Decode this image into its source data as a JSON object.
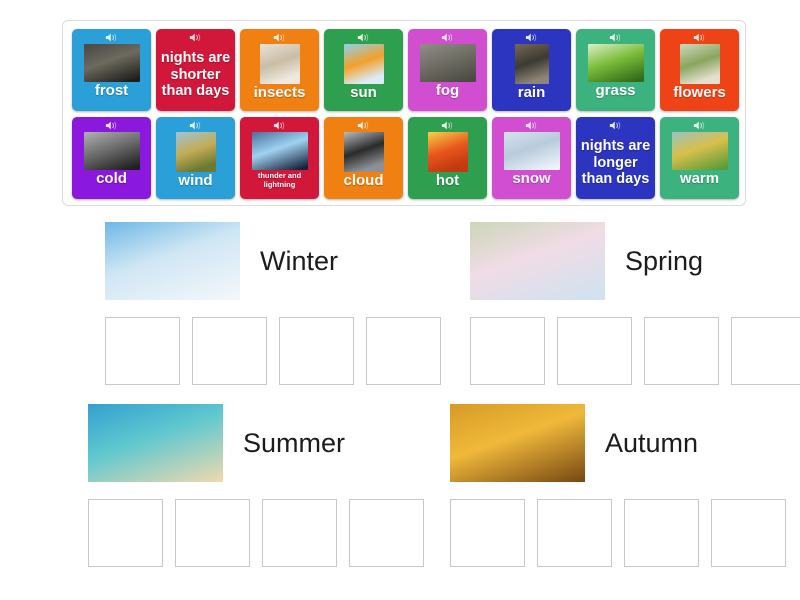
{
  "activity": {
    "type": "group-sort",
    "speaker_icon": "speaker-icon"
  },
  "tile_bank": {
    "rows": [
      [
        {
          "label": "frost",
          "color": "#2a9fd8",
          "image": "frost-photo",
          "has_image": true,
          "img_shape": "wide"
        },
        {
          "label": "nights are shorter than days",
          "color": "#d2183a",
          "image": "",
          "has_image": false,
          "img_shape": ""
        },
        {
          "label": "insects",
          "color": "#f18012",
          "image": "insect-photo",
          "has_image": true,
          "img_shape": "sq"
        },
        {
          "label": "sun",
          "color": "#2e9e4f",
          "image": "sun-photo",
          "has_image": true,
          "img_shape": "sq"
        },
        {
          "label": "fog",
          "color": "#d14ed1",
          "image": "fog-photo",
          "has_image": true,
          "img_shape": "wide"
        },
        {
          "label": "rain",
          "color": "#2b35c0",
          "image": "rain-photo",
          "has_image": true,
          "img_shape": "tall"
        },
        {
          "label": "grass",
          "color": "#3cb37e",
          "image": "grass-photo",
          "has_image": true,
          "img_shape": "wide"
        },
        {
          "label": "flowers",
          "color": "#ee4316",
          "image": "flowers-photo",
          "has_image": true,
          "img_shape": "sq"
        }
      ],
      [
        {
          "label": "cold",
          "color": "#8b18dd",
          "image": "cold-photo",
          "has_image": true,
          "img_shape": "wide"
        },
        {
          "label": "wind",
          "color": "#2a9fd8",
          "image": "wind-photo",
          "has_image": true,
          "img_shape": "sq"
        },
        {
          "label": "thunder and lightning",
          "color": "#d2183a",
          "image": "thunder-photo",
          "has_image": true,
          "img_shape": "wide",
          "small_label": true
        },
        {
          "label": "cloud",
          "color": "#f18012",
          "image": "cloud-photo",
          "has_image": true,
          "img_shape": "sq"
        },
        {
          "label": "hot",
          "color": "#2e9e4f",
          "image": "hot-photo",
          "has_image": true,
          "img_shape": "sq"
        },
        {
          "label": "snow",
          "color": "#d14ed1",
          "image": "snow-photo",
          "has_image": true,
          "img_shape": "wide"
        },
        {
          "label": "nights are longer than days",
          "color": "#2b35c0",
          "image": "",
          "has_image": false,
          "img_shape": ""
        },
        {
          "label": "warm",
          "color": "#3cb37e",
          "image": "warm-photo",
          "has_image": true,
          "img_shape": "wide"
        }
      ]
    ]
  },
  "seasons": [
    {
      "title": "Winter",
      "image": "winter-photo",
      "slots": 4
    },
    {
      "title": "Spring",
      "image": "spring-photo",
      "slots": 4
    },
    {
      "title": "Summer",
      "image": "summer-photo",
      "slots": 4
    },
    {
      "title": "Autumn",
      "image": "autumn-photo",
      "slots": 4
    }
  ]
}
